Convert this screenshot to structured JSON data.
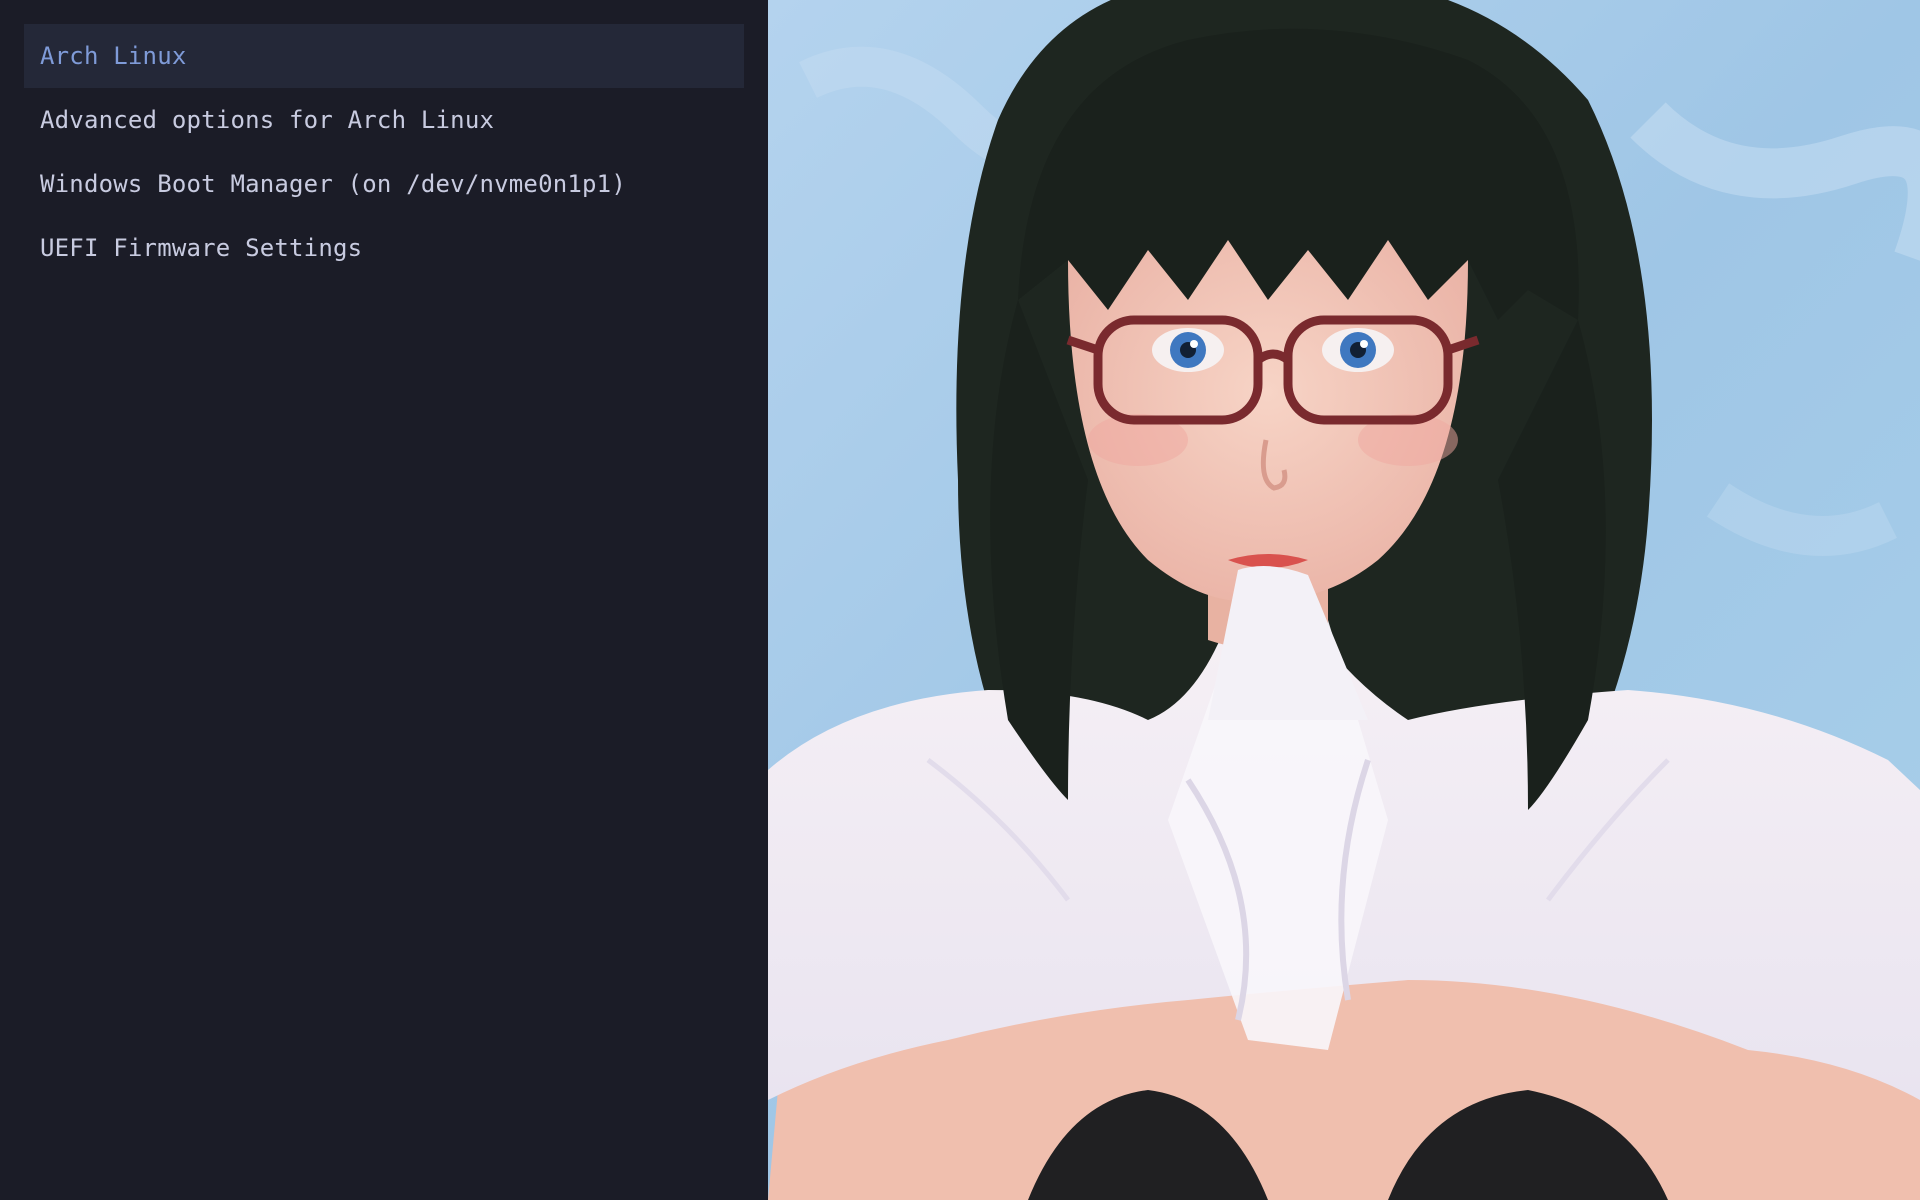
{
  "boot_menu": {
    "selected_index": 0,
    "items": [
      {
        "label": "Arch Linux"
      },
      {
        "label": "Advanced options for Arch Linux"
      },
      {
        "label": "Windows Boot Manager (on /dev/nvme0n1p1)"
      },
      {
        "label": "UEFI Firmware Settings"
      }
    ]
  },
  "background": {
    "artwork": "illustration of a girl with dark bob hair and red glasses",
    "colors": {
      "sky": "#a7cbe6",
      "hair": "#1e2620",
      "skin": "#f2c4b6",
      "shirt": "#f4eef3",
      "glasses": "#7a2a2e",
      "eyes": "#3f78c0"
    }
  },
  "panel_colors": {
    "background": "#1b1c27",
    "selected_row": "#242838",
    "selected_text": "#7f9bd8",
    "text": "#c8cbe0"
  }
}
